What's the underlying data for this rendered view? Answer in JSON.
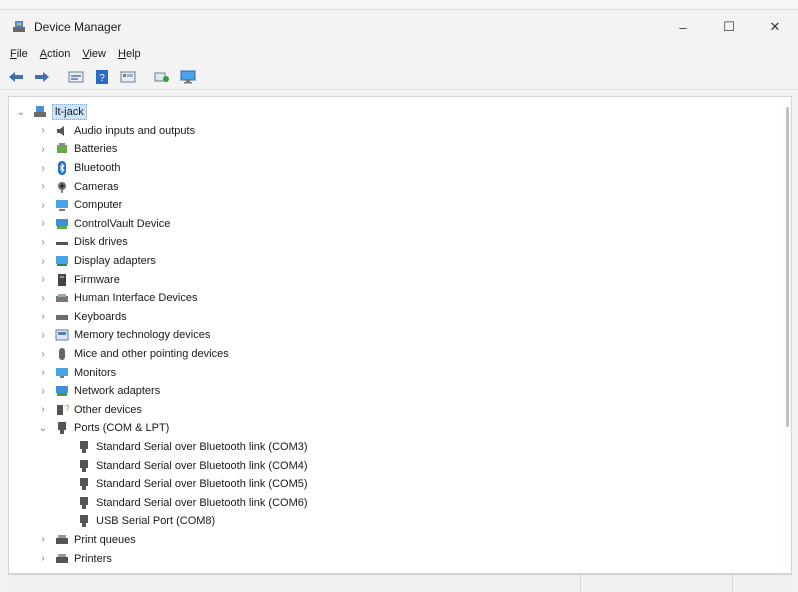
{
  "window": {
    "title": "Device Manager",
    "minimize": "–",
    "maximize": "☐",
    "close": "✕"
  },
  "menu": [
    {
      "label": "File",
      "key": "F",
      "rest": "ile"
    },
    {
      "label": "Action",
      "key": "A",
      "rest": "ction"
    },
    {
      "label": "View",
      "key": "V",
      "rest": "iew"
    },
    {
      "label": "Help",
      "key": "H",
      "rest": "elp"
    }
  ],
  "toolbar": {
    "back": "back-icon",
    "forward": "forward-icon",
    "properties": "properties-icon",
    "help": "help-icon",
    "show-hidden": "show-hidden-icon",
    "scan": "scan-hardware-icon",
    "monitor": "monitor-icon"
  },
  "tree": {
    "root": "lt-jack",
    "categories": [
      "Audio inputs and outputs",
      "Batteries",
      "Bluetooth",
      "Cameras",
      "Computer",
      "ControlVault Device",
      "Disk drives",
      "Display adapters",
      "Firmware",
      "Human Interface Devices",
      "Keyboards",
      "Memory technology devices",
      "Mice and other pointing devices",
      "Monitors",
      "Network adapters",
      "Other devices",
      "Ports (COM & LPT)"
    ],
    "ports": [
      "Standard Serial over Bluetooth link (COM3)",
      "Standard Serial over Bluetooth link (COM4)",
      "Standard Serial over Bluetooth link (COM5)",
      "Standard Serial over Bluetooth link (COM6)",
      "USB Serial Port (COM8)"
    ],
    "after": [
      "Print queues",
      "Printers"
    ]
  }
}
